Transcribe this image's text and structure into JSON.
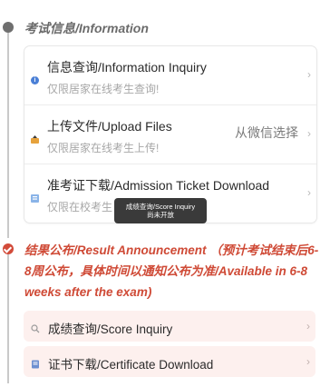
{
  "exam_info": {
    "title": "考试信息/Information",
    "items": [
      {
        "title": "信息查询/Information Inquiry",
        "subtitle": "仅限居家在线考生查询!",
        "icon": "info-icon",
        "right_text": ""
      },
      {
        "title": "上传文件/Upload Files",
        "subtitle": "仅限居家在线考生上传!",
        "icon": "upload-icon",
        "right_text": "从微信选择"
      },
      {
        "title": "准考证下载/Admission Ticket Download",
        "subtitle": "仅限在校考生",
        "icon": "ticket-icon",
        "right_text": ""
      }
    ]
  },
  "tooltip": {
    "line1": "成绩查询/Score Inquiry",
    "line2": "尚未开放"
  },
  "results": {
    "title": "结果公布/Result Announcement （预计考试结束后6-8周公布，具体时间以通知公布为准/Available in 6-8 weeks after the exam)",
    "items": [
      {
        "title": "成绩查询/Score Inquiry",
        "icon": "search-icon"
      },
      {
        "title": "证书下载/Certificate Download",
        "icon": "certificate-icon"
      }
    ]
  },
  "colors": {
    "accent_red": "#cf4a36",
    "result_bg": "#fdf0ee",
    "timeline_gray": "#6f6f6f"
  }
}
